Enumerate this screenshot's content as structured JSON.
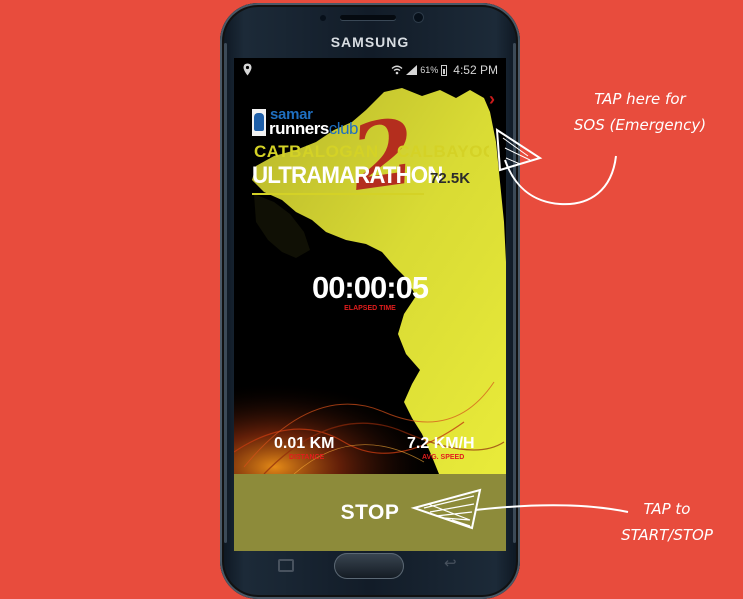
{
  "device": {
    "brand": "SAMSUNG",
    "status_bar": {
      "battery_percent": "61%",
      "time": "4:52 PM",
      "icons": [
        "location-icon",
        "wifi-icon",
        "signal-icon",
        "battery-icon"
      ]
    },
    "nav_buttons": [
      "recent-apps-icon",
      "home-button",
      "back-icon"
    ]
  },
  "app": {
    "sos_chevron": "›",
    "logo": {
      "line1": "samar",
      "line2_a": "runners",
      "line2_b": "club"
    },
    "event": {
      "number": "2",
      "route_from": "CATBALOGAN",
      "route_to": "CALBAYOG",
      "title": "ULTRAMARATHON",
      "distance": "72.5K"
    },
    "timer": {
      "value": "00:00:05",
      "label": "ELAPSED TIME"
    },
    "stats": {
      "distance_value": "0.01 KM",
      "distance_label": "DISTANCE",
      "speed_value": "7.2 KM/H",
      "speed_label": "AVG. SPEED"
    },
    "stop_button": "STOP"
  },
  "annotations": {
    "sos_line1": "TAP here for",
    "sos_line2": "SOS (Emergency)",
    "stop_line1": "TAP to",
    "stop_line2": "START/STOP"
  },
  "colors": {
    "background": "#e84c3d",
    "stop_bar": "#8d8b3a",
    "map_yellow": "#dfe13a",
    "label_red": "#e11d1d",
    "route_yellow": "#d4d226"
  }
}
